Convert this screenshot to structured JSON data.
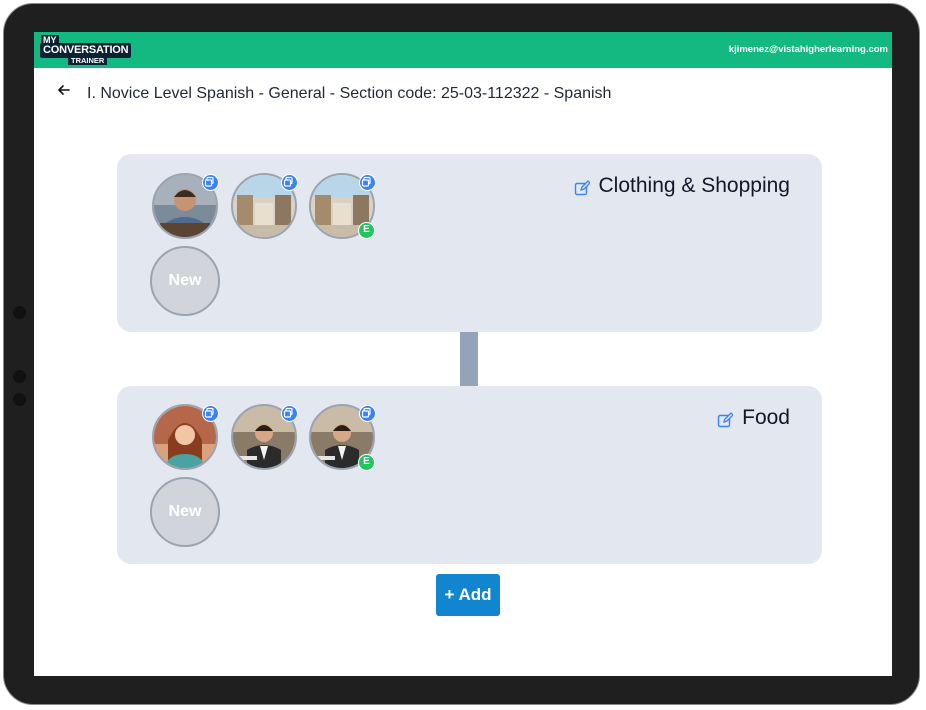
{
  "header": {
    "logo": {
      "my": "MY",
      "conversation": "CONVERSATION",
      "trainer": "TRAINER"
    },
    "user_email": "kjimenez@vistahigherlearning.com",
    "accent_color": "#13b980"
  },
  "page": {
    "breadcrumb": "I. Novice Level Spanish - General - Section code: 25-03-112322  - Spanish",
    "back_icon": "arrow-left-icon"
  },
  "topics": [
    {
      "title": "Clothing & Shopping",
      "edit_icon": "edit-icon",
      "avatars": [
        {
          "name": "man-portrait",
          "badge": "copy-icon"
        },
        {
          "name": "shopping-mall",
          "badge": "copy-icon"
        },
        {
          "name": "shopping-mall",
          "badge": "copy-icon",
          "extra_badge": "E"
        }
      ],
      "new_label": "New"
    },
    {
      "title": "Food",
      "edit_icon": "edit-icon",
      "avatars": [
        {
          "name": "woman-restaurant",
          "badge": "copy-icon"
        },
        {
          "name": "waiter",
          "badge": "copy-icon"
        },
        {
          "name": "waiter",
          "badge": "copy-icon",
          "extra_badge": "E"
        }
      ],
      "new_label": "New"
    }
  ],
  "add_button": "+ Add"
}
